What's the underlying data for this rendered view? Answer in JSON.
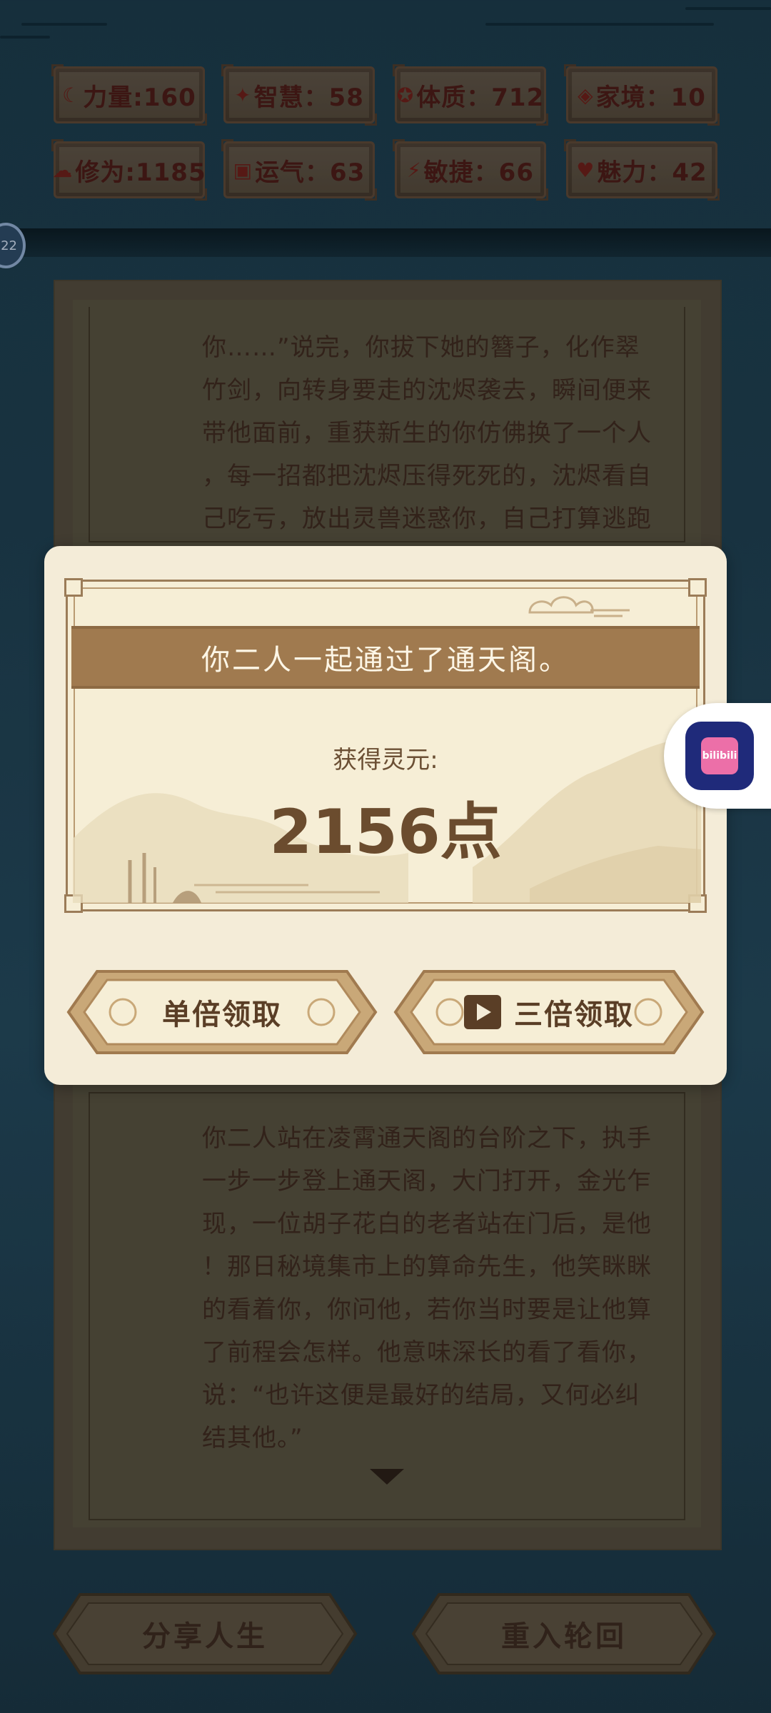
{
  "stats": [
    {
      "icon": "strength-icon",
      "glyph": "☾",
      "text": "力量:160"
    },
    {
      "icon": "wisdom-icon",
      "glyph": "✦",
      "text": "智慧：58"
    },
    {
      "icon": "constitution-icon",
      "glyph": "✪",
      "text": "体质：712"
    },
    {
      "icon": "family-icon",
      "glyph": "◈",
      "text": "家境：10"
    },
    {
      "icon": "cultivation-icon",
      "glyph": "☁",
      "text": "修为:1185"
    },
    {
      "icon": "luck-icon",
      "glyph": "▣",
      "text": "运气：63"
    },
    {
      "icon": "agility-icon",
      "glyph": "⚡",
      "text": "敏捷：66"
    },
    {
      "icon": "charm-icon",
      "glyph": "♥",
      "text": "魅力：42"
    }
  ],
  "level_badge": "22",
  "story": {
    "upper_lines": [
      "你……”说完，你拔下她的簪子，化作翠",
      "竹剑，向转身要走的沈烬袭去，瞬间便来",
      "带他面前，重获新生的你仿佛换了一个人",
      "，每一招都把沈烬压得死死的，沈烬看自",
      "己吃亏，放出灵兽迷惑你，自己打算逃跑"
    ],
    "lower_lines": [
      "你二人站在凌霄通天阁的台阶之下，执手",
      "一步一步登上通天阁，大门打开，金光乍",
      "现，一位胡子花白的老者站在门后，是他",
      "！那日秘境集市上的算命先生，他笑眯眯",
      "的看着你，你问他，若你当时要是让他算",
      "了前程会怎样。他意味深长的看了看你，",
      "说：“也许这便是最好的结局，又何必纠",
      "结其他。”"
    ]
  },
  "modal": {
    "title": "你二人一起通过了通天阁。",
    "reward_label": "获得灵元:",
    "reward_value": "2156点",
    "single_button": "单倍领取",
    "triple_button": "三倍领取"
  },
  "bottom": {
    "share_button": "分享人生",
    "rebirth_button": "重入轮回"
  },
  "floating_app_label": "bilibili",
  "colors": {
    "background": "#1e3e4f",
    "modal_bg": "#f4ecd8",
    "title_band": "#a07a4f",
    "text_brown": "#6b4c2e"
  }
}
